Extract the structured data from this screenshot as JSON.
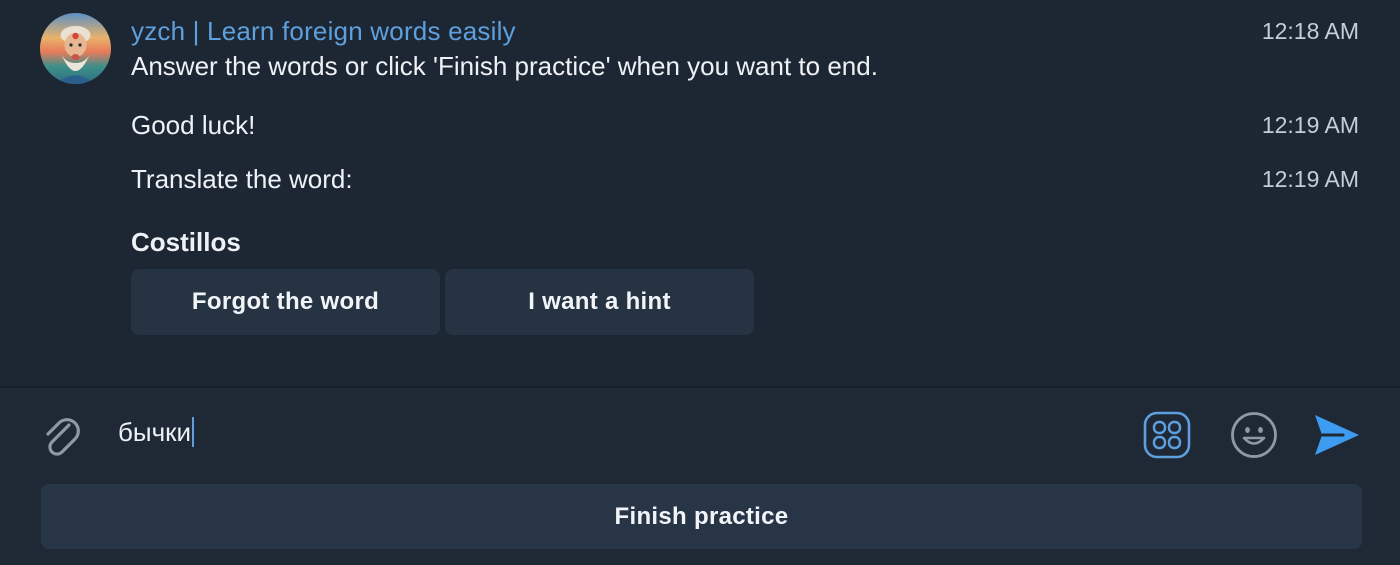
{
  "chat": {
    "sender_name": "yzch | Learn foreign words easily",
    "avatar": "bot-avatar-bearded-man",
    "messages": [
      {
        "text": "Answer the words or click 'Finish practice' when you want to end.",
        "time": "12:18 AM"
      },
      {
        "text": "Good luck!",
        "time": "12:19 AM"
      },
      {
        "text": "Translate the word:",
        "time": "12:19 AM"
      }
    ],
    "word": "Costillos",
    "inline_buttons": [
      "Forgot the word",
      "I want a hint"
    ]
  },
  "composer": {
    "input_value": "бычки",
    "icons": {
      "attach": "paperclip-icon",
      "bot_commands": "bot-commands-icon",
      "emoji": "smiley-icon",
      "send": "send-icon"
    },
    "accent_color": "#5e9fde"
  },
  "reply_keyboard": {
    "button_label": "Finish practice"
  }
}
